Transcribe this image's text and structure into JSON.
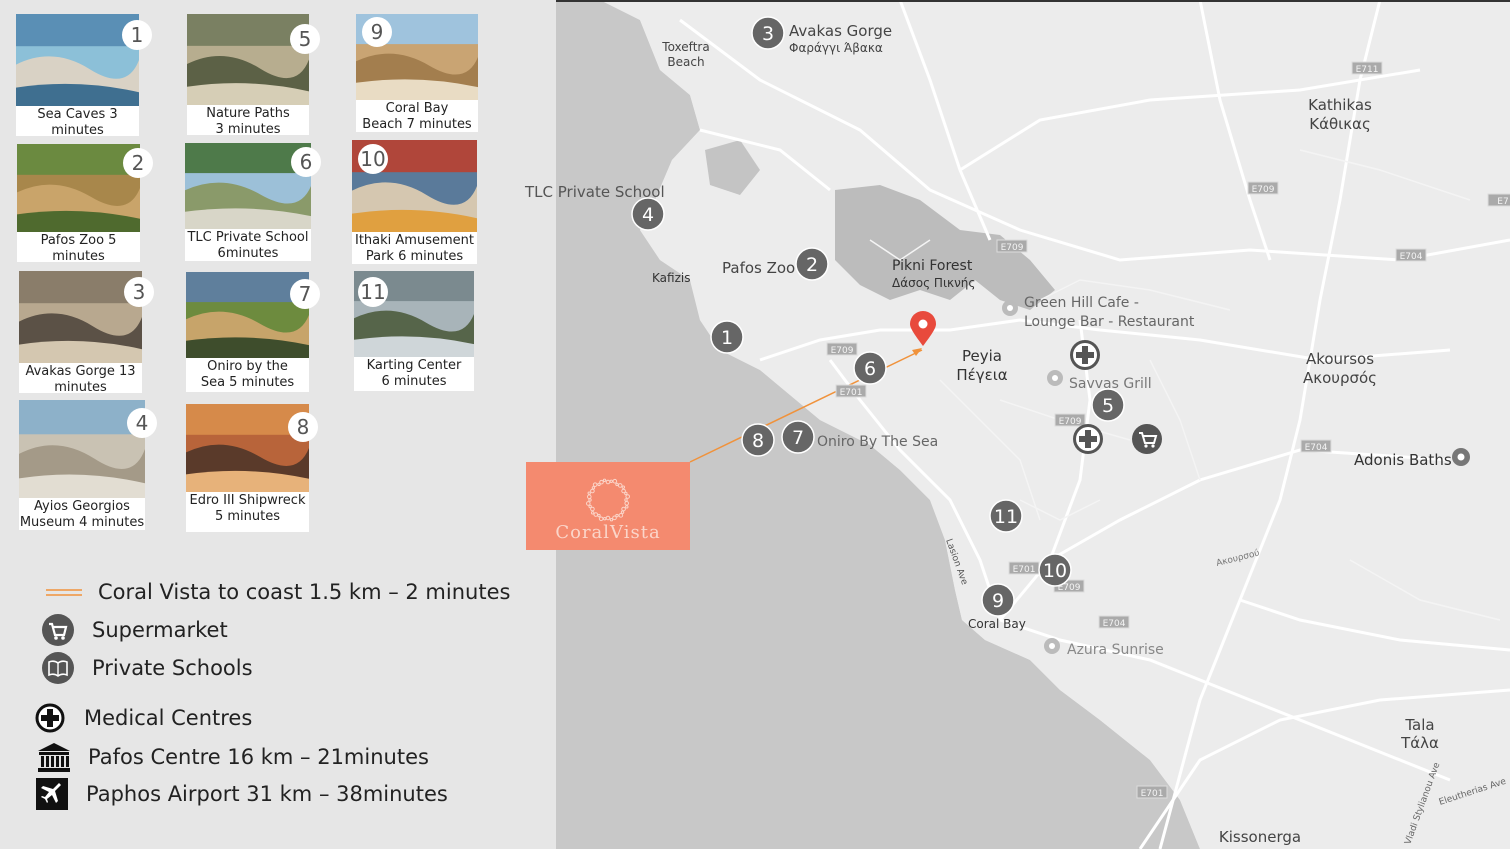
{
  "colors": {
    "map_bg": "#e8e8e8",
    "sea": "#c9c9c9",
    "forest": "#bdbdbd",
    "accent": "#f48a6f",
    "pin": "#e84a3c",
    "marker": "#666666",
    "route": "#f0923b"
  },
  "tiles": [
    {
      "num": "1",
      "caption": [
        "Sea Caves 3",
        "minutes"
      ]
    },
    {
      "num": "2",
      "caption": [
        "Pafos Zoo 5",
        "minutes"
      ]
    },
    {
      "num": "3",
      "caption": [
        "Avakas Gorge 13",
        "minutes"
      ]
    },
    {
      "num": "4",
      "caption": [
        "Ayios Georgios",
        "Museum 4 minutes"
      ]
    },
    {
      "num": "5",
      "caption": [
        "Nature Paths",
        "3 minutes"
      ]
    },
    {
      "num": "6",
      "caption": [
        "TLC Private School",
        "6minutes"
      ]
    },
    {
      "num": "7",
      "caption": [
        "Oniro by the",
        "Sea 5 minutes"
      ]
    },
    {
      "num": "8",
      "caption": [
        "Edro III Shipwreck",
        "5 minutes"
      ]
    },
    {
      "num": "9",
      "caption": [
        "Coral Bay",
        "Beach 7 minutes"
      ]
    },
    {
      "num": "10",
      "caption": [
        "Ithaki Amusement",
        "Park 6 minutes"
      ]
    },
    {
      "num": "11",
      "caption": [
        "Karting Center",
        "6 minutes"
      ]
    }
  ],
  "legend": {
    "coast": "Coral Vista to coast 1.5 km – 2 minutes",
    "supermarket": "Supermarket",
    "schools": "Private Schools",
    "medical": "Medical Centres",
    "centre": "Pafos Centre 16 km – 21minutes",
    "airport": "Paphos Airport 31 km – 38minutes"
  },
  "logo": {
    "text": "CoralVista"
  },
  "map_labels": {
    "avakas": "Avakas Gorge",
    "avakas_gr": "Φαράγγι Άβακα",
    "toxeftra": "Toxeftra",
    "toxeftra2": "Beach",
    "kathikas": "Kathikas",
    "kathikas_gr": "Κάθικας",
    "tlc": "TLC Private School",
    "kafizis": "Kafizis",
    "zoo": "Pafos Zoo",
    "forest": "Pikni Forest",
    "forest_gr": "Δάσος Πικνής",
    "greenhill": "Green Hill Cafe -",
    "greenhill2": "Lounge Bar - Restaurant",
    "peyia": "Peyia",
    "peyia_gr": "Πέγεια",
    "savvas": "Savvas Grill",
    "akoursos": "Akoursos",
    "akoursos_gr": "Ακουρσός",
    "oniro": "Oniro By The Sea",
    "adonis": "Adonis Baths",
    "akoursos_road": "Ακουρσού",
    "lasion": "Lasion Ave",
    "coralbay": "Coral Bay",
    "azura": "Azura Sunrise",
    "tala": "Tala",
    "tala_gr": "Τάλα",
    "kissonerga": "Kissonerga",
    "eleutherias": "Eleutherias Ave",
    "stylianou": "Vladi Stylianou Ave"
  },
  "roads": [
    "E711",
    "E709",
    "E709",
    "E704",
    "E709",
    "E701",
    "E709",
    "E704",
    "E701",
    "E709",
    "E704",
    "E701",
    "E7"
  ],
  "markers": [
    "1",
    "2",
    "3",
    "4",
    "5",
    "6",
    "7",
    "8",
    "9",
    "10",
    "11"
  ]
}
